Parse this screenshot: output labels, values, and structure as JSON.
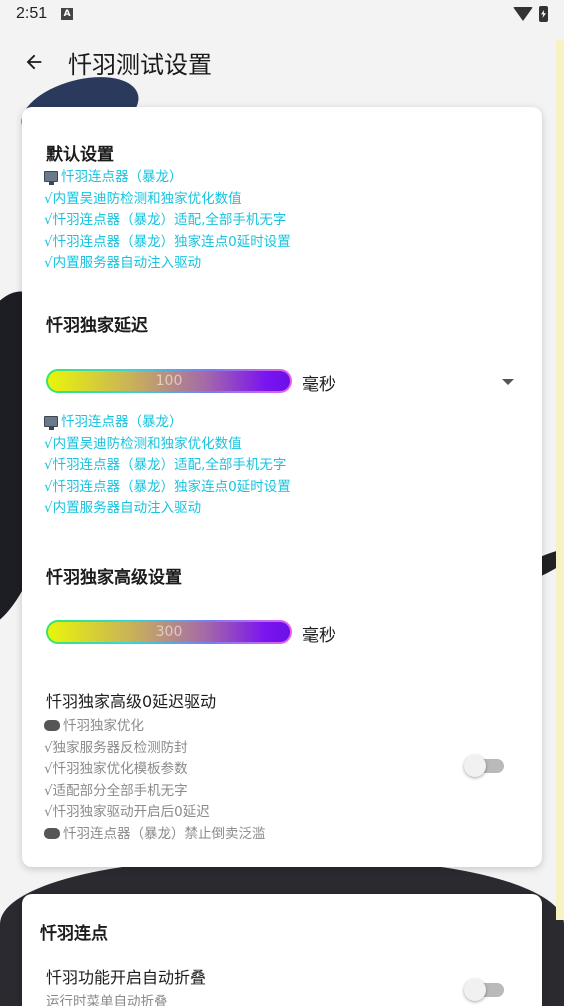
{
  "status_bar": {
    "time": "2:51",
    "notif_glyph": "A"
  },
  "app_bar": {
    "title": "忏羽测试设置"
  },
  "card_main": {
    "default_settings": {
      "title": "默认设置",
      "lines": [
        "忏羽连点器（暴龙）",
        "√内置吴迪防检测和独家优化数值",
        "√忏羽连点器（暴龙）适配,全部手机无字",
        "√忏羽连点器（暴龙）独家连点0延时设置",
        "√内置服务器自动注入驱动"
      ]
    },
    "delay": {
      "title": "忏羽独家延迟",
      "slider_value": "100",
      "unit": "毫秒",
      "lines": [
        "忏羽连点器（暴龙）",
        "√内置吴迪防检测和独家优化数值",
        "√忏羽连点器（暴龙）适配,全部手机无字",
        "√忏羽连点器（暴龙）独家连点0延时设置",
        "√内置服务器自动注入驱动"
      ]
    },
    "advanced": {
      "title": "忏羽独家高级设置",
      "slider_value": "300",
      "unit": "毫秒"
    },
    "zero_delay": {
      "title": "忏羽独家高级0延迟驱动",
      "lines": [
        "忏羽独家优化",
        "√独家服务器反检测防封",
        "√忏羽独家优化模板参数",
        "√适配部分全部手机无字",
        "√忏羽独家驱动开启后0延迟",
        "忏羽连点器（暴龙）禁止倒卖泛滥"
      ],
      "toggle_on": false
    }
  },
  "card_click": {
    "title": "忏羽连点",
    "fold_setting": {
      "title": "忏羽功能开启自动折叠",
      "subtitle": "运行时菜单自动折叠",
      "toggle_on": false
    }
  },
  "colors": {
    "info_cyan": "#19c3de",
    "info_grey": "#8a8a8a"
  }
}
